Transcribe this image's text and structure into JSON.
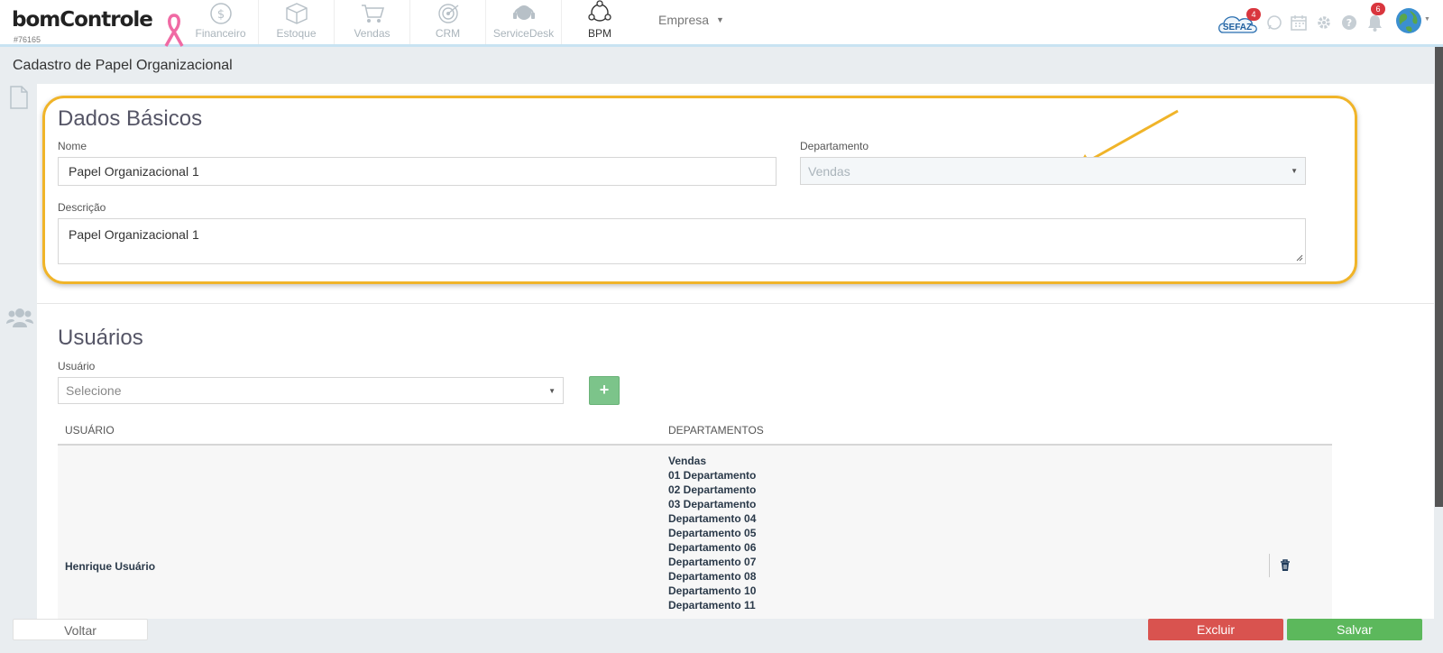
{
  "brand": {
    "name": "bomControle",
    "account_code": "#76165"
  },
  "nav": {
    "modules": [
      {
        "label": "Financeiro",
        "icon": "dollar-coin-icon"
      },
      {
        "label": "Estoque",
        "icon": "box-icon"
      },
      {
        "label": "Vendas",
        "icon": "shopping-cart-icon"
      },
      {
        "label": "CRM",
        "icon": "target-icon"
      },
      {
        "label": "ServiceDesk",
        "icon": "headset-icon"
      },
      {
        "label": "BPM",
        "icon": "process-cycle-icon"
      }
    ],
    "active_module": "BPM",
    "company_menu": "Empresa",
    "sefaz_label": "SEFAZ",
    "sefaz_badge": "4",
    "notifications_badge": "6"
  },
  "page": {
    "title": "Cadastro de Papel Organizacional"
  },
  "basic_data": {
    "heading": "Dados Básicos",
    "name_label": "Nome",
    "name_value": "Papel Organizacional 1",
    "department_label": "Departamento",
    "department_value": "Vendas",
    "description_label": "Descrição",
    "description_value": "Papel Organizacional 1"
  },
  "users": {
    "heading": "Usuários",
    "user_label": "Usuário",
    "user_placeholder": "Selecione",
    "add_label": "+",
    "columns": [
      "USUÁRIO",
      "DEPARTAMENTOS"
    ],
    "rows": [
      {
        "user": "Henrique Usuário",
        "departments": [
          "Vendas",
          "01 Departamento",
          "02 Departamento",
          "03 Departamento",
          "Departamento 04",
          "Departamento 05",
          "Departamento 06",
          "Departamento 07",
          "Departamento 08",
          "Departamento 10",
          "Departamento 11"
        ]
      }
    ]
  },
  "footer": {
    "back_label": "Voltar",
    "delete_label": "Excluir",
    "save_label": "Salvar"
  },
  "colors": {
    "highlight": "#f0b429",
    "danger": "#d9534f",
    "success": "#5cb85c",
    "badge": "#d9363e"
  }
}
